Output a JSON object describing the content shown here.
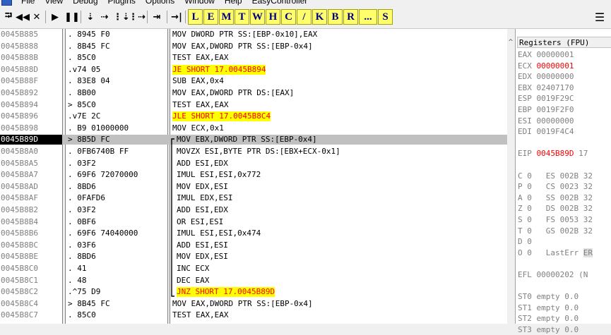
{
  "menu": {
    "items": [
      "File",
      "View",
      "Debug",
      "Plugins",
      "Options",
      "Window",
      "Help",
      "EasyController"
    ]
  },
  "toolbar": {
    "icons": [
      "open-icon",
      "rewind-icon",
      "close-icon",
      "run-icon",
      "pause-icon",
      "step-into-icon",
      "step-over-icon",
      "trace-into-icon",
      "trace-over-icon",
      "execute-till-return-icon",
      "goto-icon"
    ],
    "icon_glyphs": [
      "⮒",
      "◀◀",
      "✕",
      "▶",
      "❚❚",
      "⇣",
      "⇢",
      "⋮⇣",
      "⋮⇢",
      "⇥",
      "→|"
    ],
    "letters": [
      "L",
      "E",
      "M",
      "T",
      "W",
      "H",
      "C",
      "/",
      "K",
      "B",
      "R",
      "...",
      "S"
    ]
  },
  "rows": [
    {
      "addr": "0045B885",
      "bytes": ". 8945 F0",
      "mnem": "MOV DWORD PTR SS:[EBP-0x10],EAX",
      "jump": false
    },
    {
      "addr": "0045B888",
      "bytes": ". 8B45 FC",
      "mnem": "MOV EAX,DWORD PTR SS:[EBP-0x4]",
      "jump": false
    },
    {
      "addr": "0045B88B",
      "bytes": ". 85C0",
      "mnem": "TEST EAX,EAX",
      "jump": false
    },
    {
      "addr": "0045B88D",
      "bytes": ".v74 05",
      "mnem": "JE SHORT 17.0045B894",
      "jump": true
    },
    {
      "addr": "0045B88F",
      "bytes": ". 83E8 04",
      "mnem": "SUB EAX,0x4",
      "jump": false
    },
    {
      "addr": "0045B892",
      "bytes": ". 8B00",
      "mnem": "MOV EAX,DWORD PTR DS:[EAX]",
      "jump": false
    },
    {
      "addr": "0045B894",
      "bytes": "> 85C0",
      "mnem": "TEST EAX,EAX",
      "jump": false
    },
    {
      "addr": "0045B896",
      "bytes": ".v7E 2C",
      "mnem": "JLE SHORT 17.0045B8C4",
      "jump": true
    },
    {
      "addr": "0045B898",
      "bytes": ". B9 01000000",
      "mnem": "MOV ECX,0x1",
      "jump": false
    },
    {
      "addr": "0045B89D",
      "bytes": "> 8B5D FC",
      "mnem": "MOV EBX,DWORD PTR SS:[EBP-0x4]",
      "jump": false,
      "selected": true
    },
    {
      "addr": "0045B8A0",
      "bytes": ". 0FB6740B FF",
      "mnem": "MOVZX ESI,BYTE PTR DS:[EBX+ECX-0x1]",
      "jump": false
    },
    {
      "addr": "0045B8A5",
      "bytes": ". 03F2",
      "mnem": "ADD ESI,EDX",
      "jump": false
    },
    {
      "addr": "0045B8A7",
      "bytes": ". 69F6 72070000",
      "mnem": "IMUL ESI,ESI,0x772",
      "jump": false
    },
    {
      "addr": "0045B8AD",
      "bytes": ". 8BD6",
      "mnem": "MOV EDX,ESI",
      "jump": false
    },
    {
      "addr": "0045B8AF",
      "bytes": ". 0FAFD6",
      "mnem": "IMUL EDX,ESI",
      "jump": false
    },
    {
      "addr": "0045B8B2",
      "bytes": ". 03F2",
      "mnem": "ADD ESI,EDX",
      "jump": false
    },
    {
      "addr": "0045B8B4",
      "bytes": ". 0BF6",
      "mnem": "OR ESI,ESI",
      "jump": false
    },
    {
      "addr": "0045B8B6",
      "bytes": ". 69F6 74040000",
      "mnem": "IMUL ESI,ESI,0x474",
      "jump": false
    },
    {
      "addr": "0045B8BC",
      "bytes": ". 03F6",
      "mnem": "ADD ESI,ESI",
      "jump": false
    },
    {
      "addr": "0045B8BE",
      "bytes": ". 8BD6",
      "mnem": "MOV EDX,ESI",
      "jump": false
    },
    {
      "addr": "0045B8C0",
      "bytes": ". 41",
      "mnem": "INC ECX",
      "jump": false
    },
    {
      "addr": "0045B8C1",
      "bytes": ". 48",
      "mnem": "DEC EAX",
      "jump": false
    },
    {
      "addr": "0045B8C2",
      "bytes": ".^75 D9",
      "mnem": "JNZ SHORT 17.0045B89D",
      "jump": true
    },
    {
      "addr": "0045B8C4",
      "bytes": "> 8B45 FC",
      "mnem": "MOV EAX,DWORD PTR SS:[EBP-0x4]",
      "jump": false
    },
    {
      "addr": "0045B8C7",
      "bytes": ". 85C0",
      "mnem": "TEST EAX,EAX",
      "jump": false
    }
  ],
  "registers": {
    "header": "Registers (FPU)",
    "lines": [
      {
        "text": "EAX 00000001",
        "red": false
      },
      {
        "text": "ECX 00000001",
        "red": true
      },
      {
        "text": "EDX 00000000",
        "red": false
      },
      {
        "text": "EBX 02407170",
        "red": false
      },
      {
        "text": "ESP 0019F29C",
        "red": false
      },
      {
        "text": "EBP 0019F2F0",
        "red": false
      },
      {
        "text": "ESI 00000000",
        "red": false
      },
      {
        "text": "EDI 0019F4C4",
        "red": false
      },
      {
        "text": "",
        "red": false
      },
      {
        "text": "EIP 0045B89D 17",
        "red": true
      },
      {
        "text": "",
        "red": false
      },
      {
        "text": "C 0   ES 002B 32",
        "red": false
      },
      {
        "text": "P 0   CS 0023 32",
        "red": false
      },
      {
        "text": "A 0   SS 002B 32",
        "red": false
      },
      {
        "text": "Z 0   DS 002B 32",
        "red": false
      },
      {
        "text": "S 0   FS 0053 32",
        "red": false
      },
      {
        "text": "T 0   GS 002B 32",
        "red": false
      },
      {
        "text": "D 0",
        "red": false
      },
      {
        "text": "O 0   LastErr ER",
        "red": false
      },
      {
        "text": "",
        "red": false
      },
      {
        "text": "EFL 00000202 (N",
        "red": false
      },
      {
        "text": "",
        "red": false
      },
      {
        "text": "ST0 empty 0.0",
        "red": false
      },
      {
        "text": "ST1 empty 0.0",
        "red": false
      },
      {
        "text": "ST2 empty 0.0",
        "red": false
      },
      {
        "text": "ST3 empty 0.0",
        "red": false
      }
    ]
  },
  "colors": {
    "jump_bg": "#ffff00",
    "jump_fg": "#ff0000",
    "address_fg": "#808080",
    "toolbar_letter_bg": "#ffff6e",
    "selected_row_bg": "#c0c0c0"
  }
}
